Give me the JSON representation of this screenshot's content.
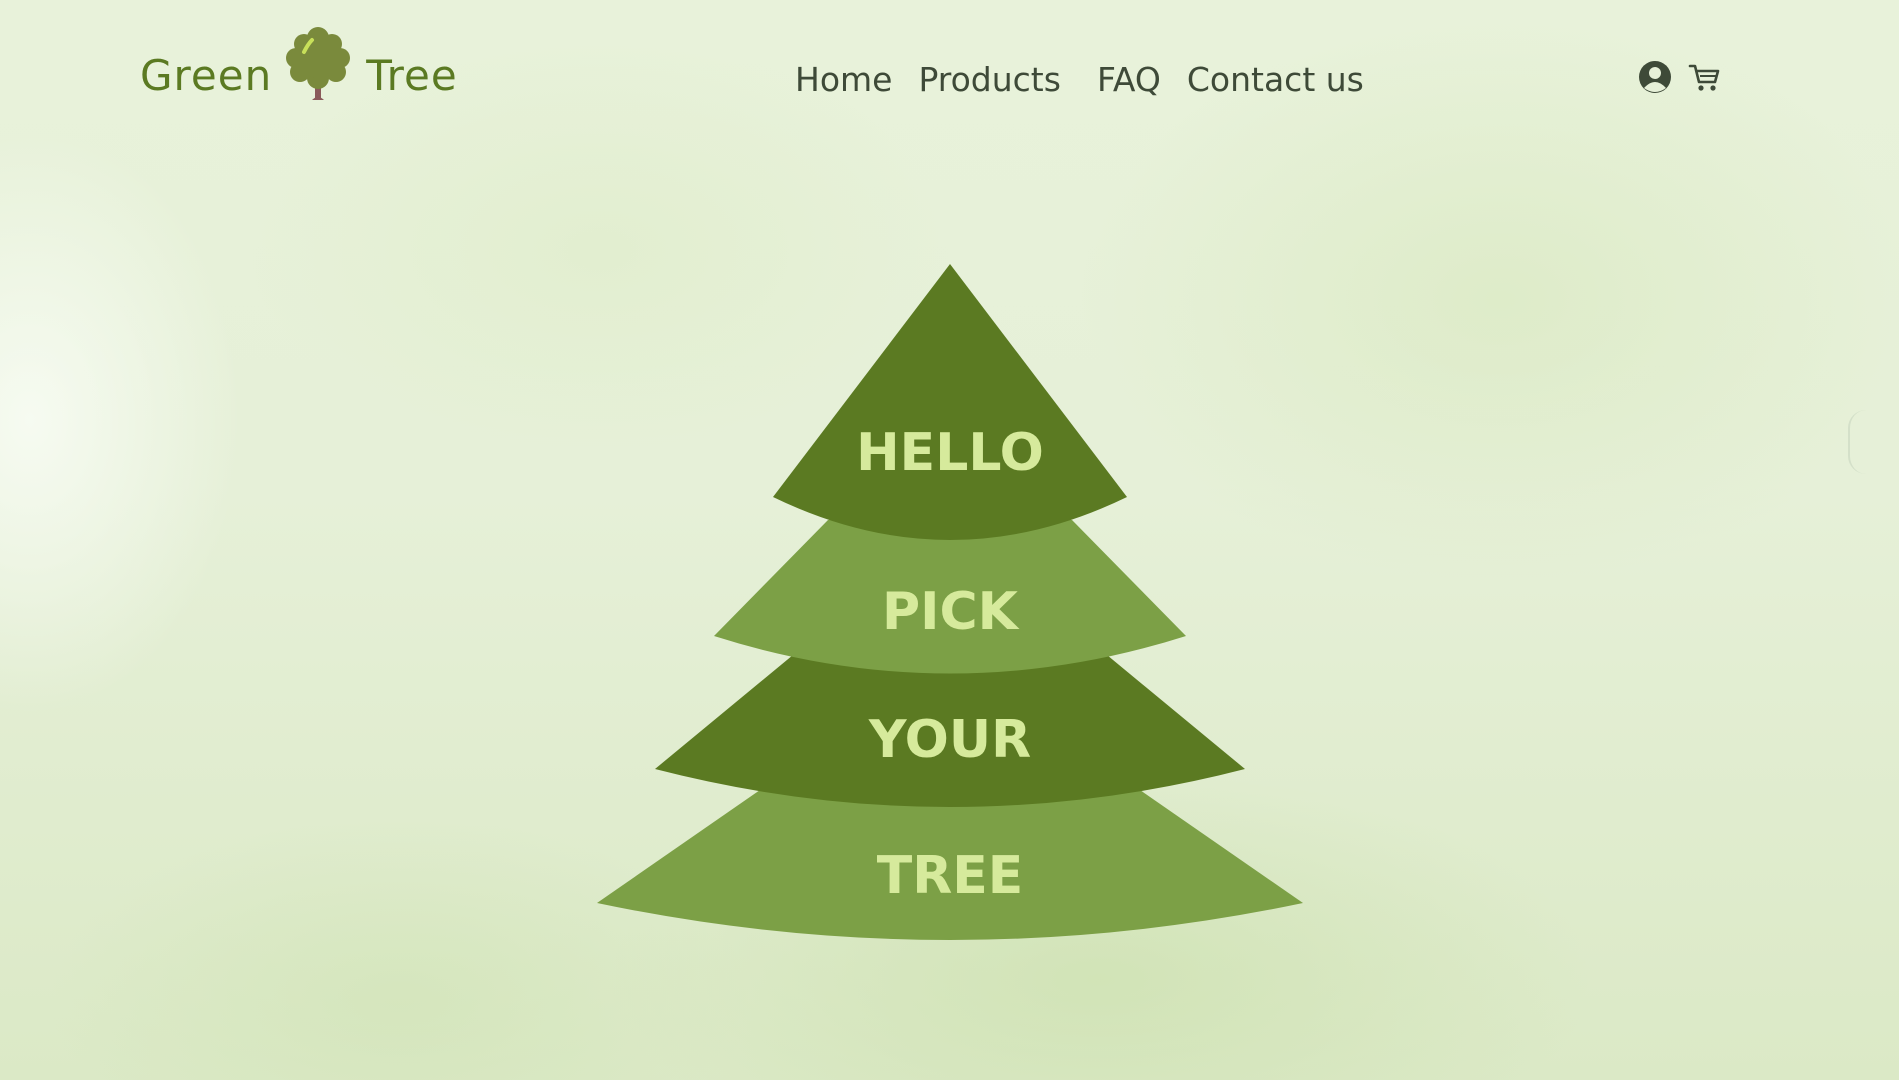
{
  "brand": {
    "word_left": "Green",
    "word_right": "Tree",
    "logo_icon": "tree-icon"
  },
  "nav": {
    "items": [
      {
        "label": "Home"
      },
      {
        "label": "Products"
      },
      {
        "label": "FAQ"
      },
      {
        "label": "Contact us"
      }
    ]
  },
  "header_icons": {
    "account": "user-circle-icon",
    "cart": "cart-icon"
  },
  "hero": {
    "tiers": [
      {
        "label": "HELLO"
      },
      {
        "label": "PICK"
      },
      {
        "label": "YOUR"
      },
      {
        "label": "TREE"
      }
    ]
  },
  "colors": {
    "brand_green": "#5b7a22",
    "tier_dark": "#5b7a22",
    "tier_light": "#7ca046",
    "tier_text": "#d6ea9c",
    "nav_text": "#3e4a38"
  }
}
